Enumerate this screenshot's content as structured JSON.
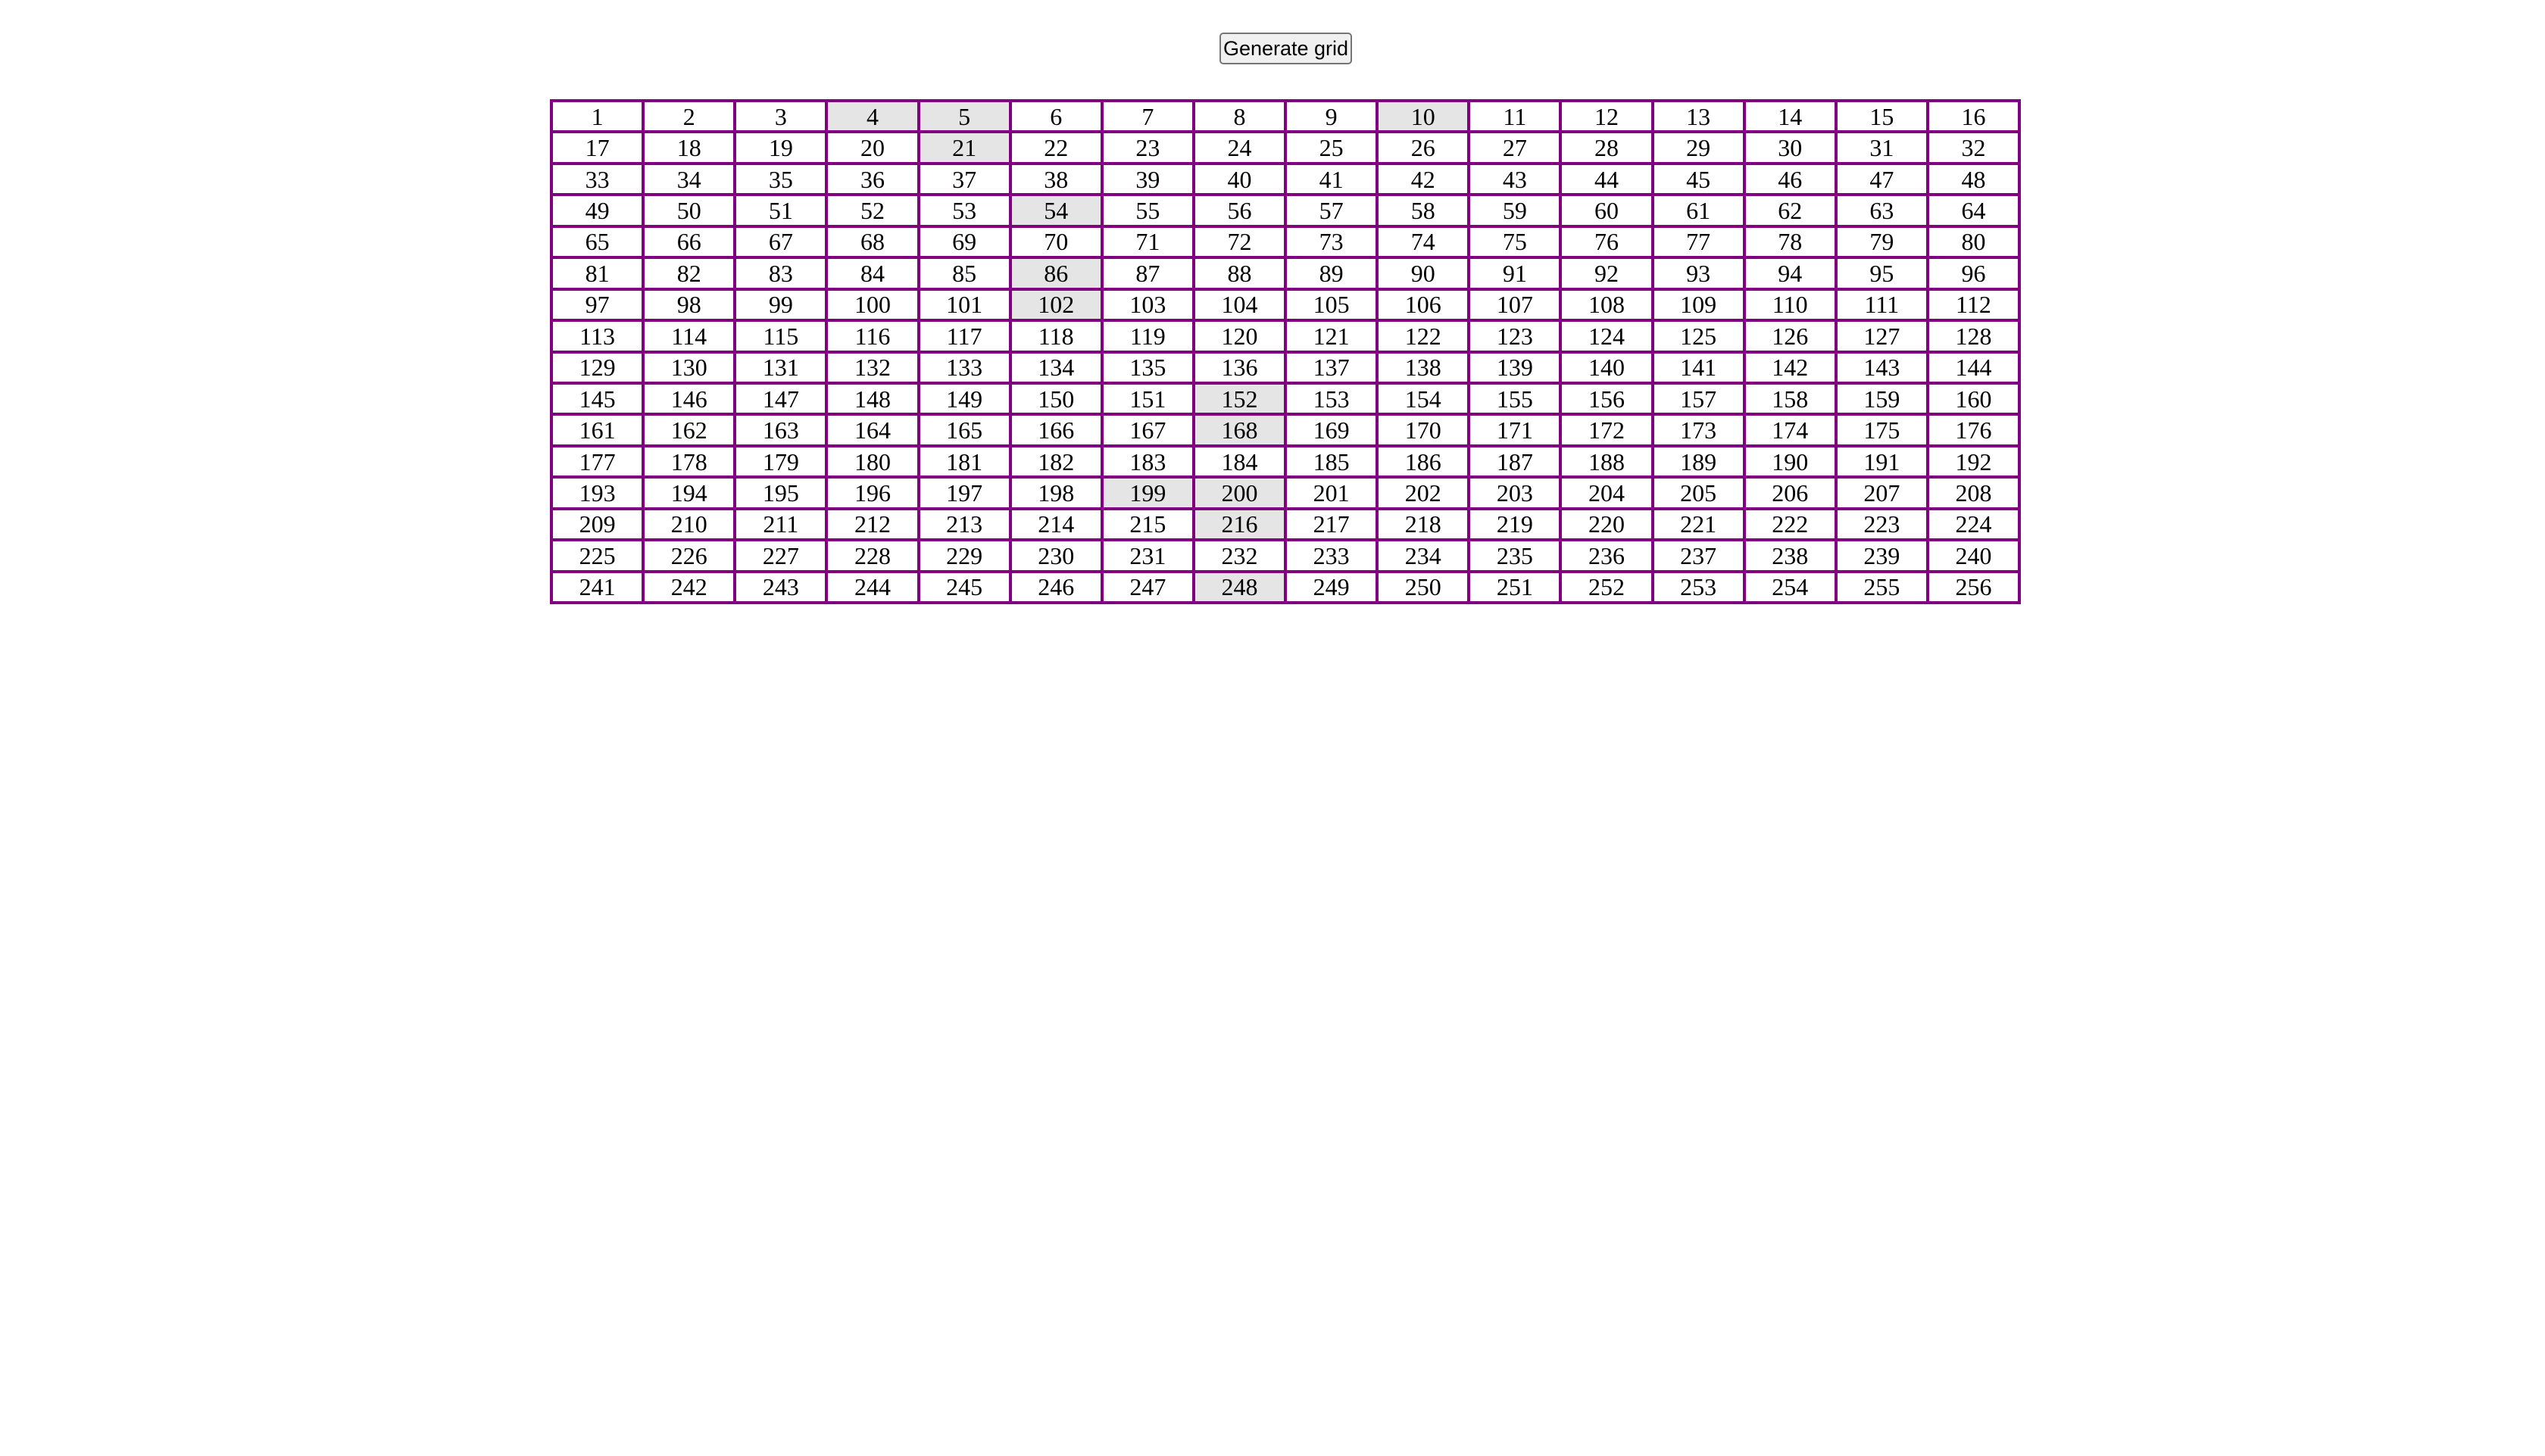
{
  "controls": {
    "generate_label": "Generate grid"
  },
  "grid": {
    "rows": 16,
    "cols": 16,
    "border_color": "#800080",
    "cell_background": "#ffffff",
    "highlight_background": "#e5e5e5",
    "cells": [
      "1",
      "2",
      "3",
      "4",
      "5",
      "6",
      "7",
      "8",
      "9",
      "10",
      "11",
      "12",
      "13",
      "14",
      "15",
      "16",
      "17",
      "18",
      "19",
      "20",
      "21",
      "22",
      "23",
      "24",
      "25",
      "26",
      "27",
      "28",
      "29",
      "30",
      "31",
      "32",
      "33",
      "34",
      "35",
      "36",
      "37",
      "38",
      "39",
      "40",
      "41",
      "42",
      "43",
      "44",
      "45",
      "46",
      "47",
      "48",
      "49",
      "50",
      "51",
      "52",
      "53",
      "54",
      "55",
      "56",
      "57",
      "58",
      "59",
      "60",
      "61",
      "62",
      "63",
      "64",
      "65",
      "66",
      "67",
      "68",
      "69",
      "70",
      "71",
      "72",
      "73",
      "74",
      "75",
      "76",
      "77",
      "78",
      "79",
      "80",
      "81",
      "82",
      "83",
      "84",
      "85",
      "86",
      "87",
      "88",
      "89",
      "90",
      "91",
      "92",
      "93",
      "94",
      "95",
      "96",
      "97",
      "98",
      "99",
      "100",
      "101",
      "102",
      "103",
      "104",
      "105",
      "106",
      "107",
      "108",
      "109",
      "110",
      "111",
      "112",
      "113",
      "114",
      "115",
      "116",
      "117",
      "118",
      "119",
      "120",
      "121",
      "122",
      "123",
      "124",
      "125",
      "126",
      "127",
      "128",
      "129",
      "130",
      "131",
      "132",
      "133",
      "134",
      "135",
      "136",
      "137",
      "138",
      "139",
      "140",
      "141",
      "142",
      "143",
      "144",
      "145",
      "146",
      "147",
      "148",
      "149",
      "150",
      "151",
      "152",
      "153",
      "154",
      "155",
      "156",
      "157",
      "158",
      "159",
      "160",
      "161",
      "162",
      "163",
      "164",
      "165",
      "166",
      "167",
      "168",
      "169",
      "170",
      "171",
      "172",
      "173",
      "174",
      "175",
      "176",
      "177",
      "178",
      "179",
      "180",
      "181",
      "182",
      "183",
      "184",
      "185",
      "186",
      "187",
      "188",
      "189",
      "190",
      "191",
      "192",
      "193",
      "194",
      "195",
      "196",
      "197",
      "198",
      "199",
      "200",
      "201",
      "202",
      "203",
      "204",
      "205",
      "206",
      "207",
      "208",
      "209",
      "210",
      "211",
      "212",
      "213",
      "214",
      "215",
      "216",
      "217",
      "218",
      "219",
      "220",
      "221",
      "222",
      "223",
      "224",
      "225",
      "226",
      "227",
      "228",
      "229",
      "230",
      "231",
      "232",
      "233",
      "234",
      "235",
      "236",
      "237",
      "238",
      "239",
      "240",
      "241",
      "242",
      "243",
      "244",
      "245",
      "246",
      "247",
      "248",
      "249",
      "250",
      "251",
      "252",
      "253",
      "254",
      "255",
      "256"
    ],
    "highlighted": [
      "4",
      "5",
      "10",
      "21",
      "54",
      "86",
      "102",
      "152",
      "168",
      "199",
      "200",
      "216",
      "248"
    ]
  }
}
